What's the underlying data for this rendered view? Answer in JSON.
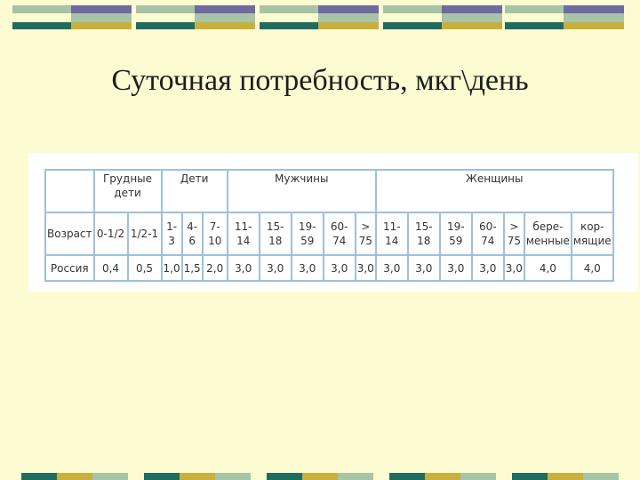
{
  "title": "Суточная потребность, мкг\\день",
  "decoration": {
    "colors": {
      "teal": "#1e6d5e",
      "olive": "#c9b03c",
      "purple": "#6f6aa0",
      "sage": "#a7c5a6",
      "cream": "#fdfbd2"
    },
    "pattern": "tiled-color-blocks"
  },
  "table": {
    "header_groups": {
      "blank": "",
      "infants": "Грудные дети",
      "children": "Дети",
      "men": "Мужчины",
      "women": "Женщины"
    },
    "age_label": "Возраст",
    "ages": [
      "0-1/2",
      "1/2-1",
      "1-3",
      "4-6",
      "7-10",
      "11-14",
      "15-18",
      "19-59",
      "60-74",
      "> 75",
      "11-14",
      "15-18",
      "19-59",
      "60-74",
      "> 75",
      "бере-менные",
      "кор-мящие"
    ],
    "country_label": "Россия",
    "values": [
      "0,4",
      "0,5",
      "1,0",
      "1,5",
      "2,0",
      "3,0",
      "3,0",
      "3,0",
      "3,0",
      "3,0",
      "3,0",
      "3,0",
      "3,0",
      "3,0",
      "3,0",
      "4,0",
      "4,0"
    ]
  }
}
